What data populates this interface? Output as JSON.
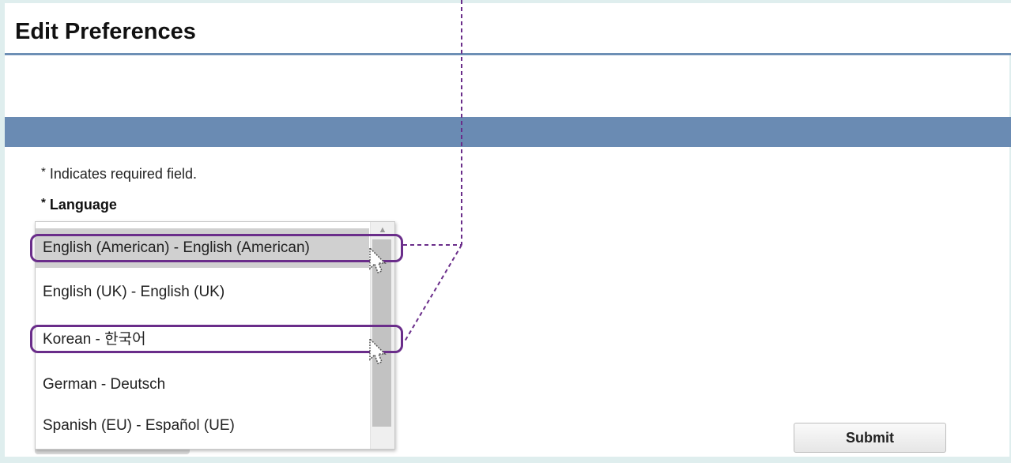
{
  "page": {
    "title": "Edit Preferences"
  },
  "form": {
    "required_star": "*",
    "required_note": "Indicates required field.",
    "language_label": "Language",
    "submit_label": "Submit"
  },
  "language_list": {
    "selected": "English (American) - English (American)",
    "options": [
      "English (American) - English (American)",
      "English (UK) - English (UK)",
      "Korean - 한국어",
      "German - Deutsch",
      "Spanish (EU) - Español (UE)"
    ]
  },
  "colors": {
    "header_rule": "#6d8fb5",
    "band": "#6a8bb3",
    "highlight": "#6a2d8a",
    "selected_option": "#d0d0d0"
  }
}
